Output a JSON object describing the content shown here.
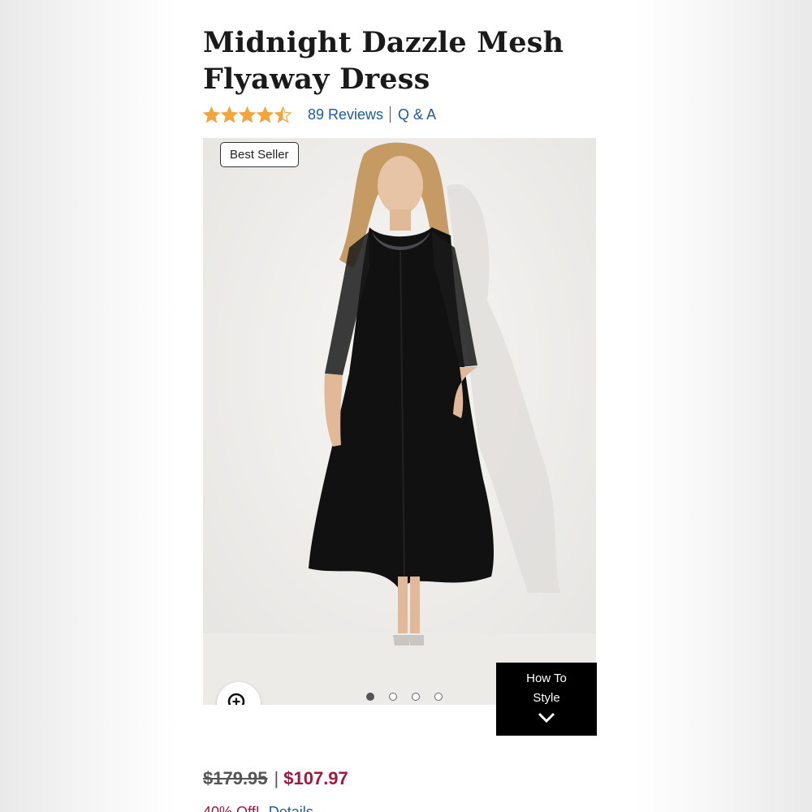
{
  "product": {
    "title_line1": "Midnight Dazzle Mesh",
    "title_line2": "Flyaway Dress",
    "rating": 4.5,
    "reviews_label": "89 Reviews",
    "qa_label": "Q & A"
  },
  "gallery": {
    "badge": "Best Seller",
    "image_count": 4,
    "active_index": 0,
    "how_to_line1": "How To",
    "how_to_line2": "Style"
  },
  "pricing": {
    "original": "$179.95",
    "separator": "|",
    "sale": "$107.97",
    "promo_text": "40% Off!",
    "promo_link": "Details"
  },
  "colors": {
    "link": "#1d5ba6",
    "sale": "#a8153d",
    "star": "#f3a53c"
  },
  "icons": {
    "zoom": "zoom-in-icon",
    "chevron": "chevron-down-icon",
    "star": "star-icon"
  }
}
